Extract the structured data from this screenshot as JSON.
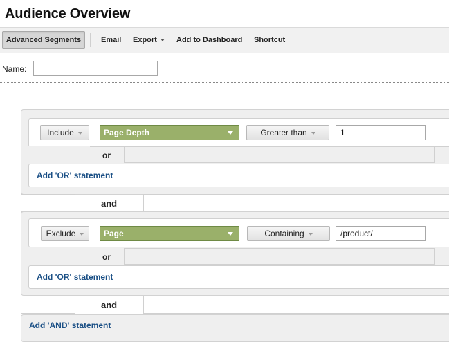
{
  "header": {
    "title": "Audience Overview"
  },
  "toolbar": {
    "advanced_segments": "Advanced Segments",
    "email": "Email",
    "export": "Export",
    "add_to_dashboard": "Add to Dashboard",
    "shortcut": "Shortcut"
  },
  "name_field": {
    "label": "Name:",
    "value": ""
  },
  "segment_blocks": [
    {
      "mode": "Include",
      "dimension": "Page Depth",
      "operator": "Greater than",
      "value": "1",
      "or_label": "or",
      "add_or": "Add 'OR' statement"
    },
    {
      "mode": "Exclude",
      "dimension": "Page",
      "operator": "Containing",
      "value": "/product/",
      "or_label": "or",
      "add_or": "Add 'OR' statement"
    }
  ],
  "and_label": "and",
  "add_and": "Add 'AND' statement",
  "colors": {
    "dimension_green": "#9ab06a",
    "link_blue": "#1a4f85"
  }
}
